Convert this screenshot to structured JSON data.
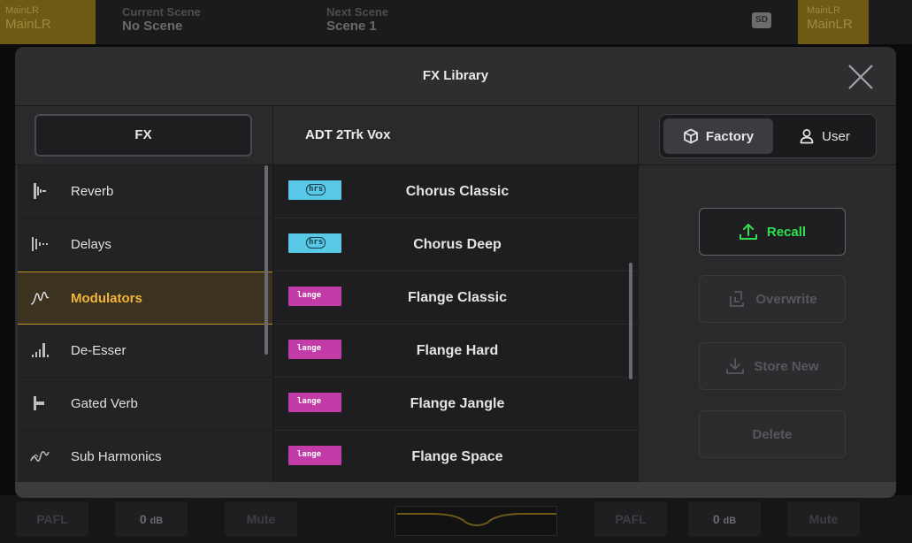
{
  "background": {
    "topbar": {
      "left_label_small": "MainLR",
      "left_label": "MainLR",
      "current_scene_label": "Current Scene",
      "current_scene_value": "No Scene",
      "next_scene_label": "Next Scene",
      "next_scene_value": "Scene 1",
      "sd_icon": "SD",
      "right_label_small": "MainLR",
      "right_label": "MainLR"
    },
    "bottombar": {
      "pafl_left": "PAFL",
      "gain_left_value": "0",
      "gain_left_unit": "dB",
      "mute_left": "Mute",
      "pafl_right": "PAFL",
      "gain_right_value": "0",
      "gain_right_unit": "dB",
      "mute_right": "Mute"
    }
  },
  "dialog": {
    "title": "FX Library",
    "fx_button": "FX",
    "preset_name": "ADT 2Trk Vox",
    "source_tabs": [
      {
        "label": "Factory",
        "icon": "box-icon",
        "active": true
      },
      {
        "label": "User",
        "icon": "user-icon",
        "active": false
      }
    ],
    "categories": [
      {
        "label": "Reverb",
        "icon": "reverb-icon",
        "selected": false
      },
      {
        "label": "Delays",
        "icon": "delays-icon",
        "selected": false
      },
      {
        "label": "Modulators",
        "icon": "modulators-icon",
        "selected": true
      },
      {
        "label": "De-Esser",
        "icon": "de-esser-icon",
        "selected": false
      },
      {
        "label": "Gated Verb",
        "icon": "gated-verb-icon",
        "selected": false
      },
      {
        "label": "Sub Harmonics",
        "icon": "sub-harmonics-icon",
        "selected": false
      }
    ],
    "presets": [
      {
        "name": "Chorus Classic",
        "badge": "chorus",
        "badge_text": "hrs"
      },
      {
        "name": "Chorus Deep",
        "badge": "chorus",
        "badge_text": "hrs"
      },
      {
        "name": "Flange Classic",
        "badge": "flange",
        "badge_text": "lange"
      },
      {
        "name": "Flange Hard",
        "badge": "flange",
        "badge_text": "lange"
      },
      {
        "name": "Flange Jangle",
        "badge": "flange",
        "badge_text": "lange"
      },
      {
        "name": "Flange Space",
        "badge": "flange",
        "badge_text": "lange"
      }
    ],
    "actions": {
      "recall": "Recall",
      "overwrite": "Overwrite",
      "store_new": "Store New",
      "delete": "Delete"
    }
  },
  "colors": {
    "accent_selected": "#f2b43c",
    "recall_green": "#2ee04f",
    "chorus_badge": "#57c9e6",
    "flange_badge": "#c23ba6"
  }
}
